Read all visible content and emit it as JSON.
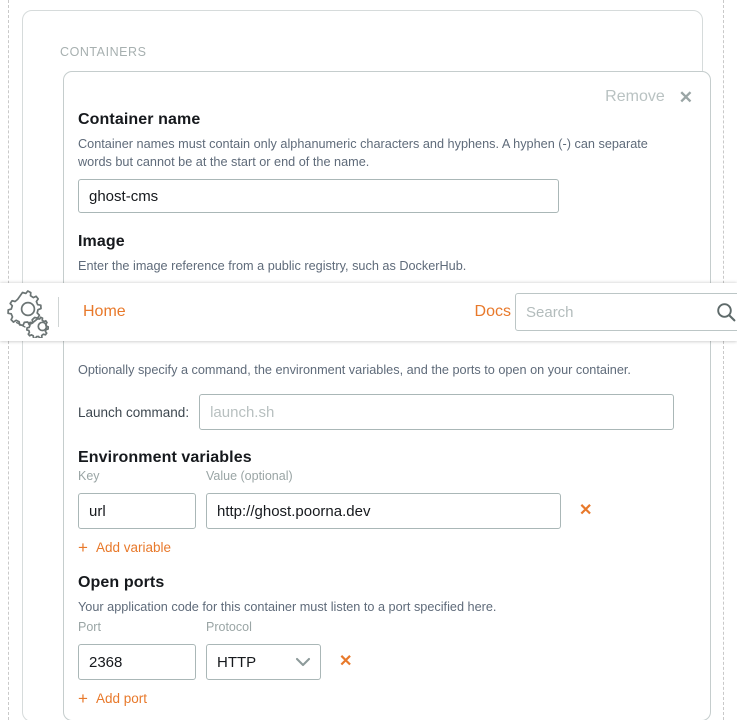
{
  "section": {
    "label": "CONTAINERS"
  },
  "container_card": {
    "remove_label": "Remove",
    "remove_icon": "close-icon",
    "fields": {
      "container_name": {
        "heading": "Container name",
        "help": "Container names must contain only alphanumeric characters and hyphens. A hyphen (-) can separate words but cannot be at the start or end of the name.",
        "value": "ghost-cms",
        "placeholder": ""
      },
      "image": {
        "heading": "Image",
        "help": "Enter the image reference from a public registry, such as DockerHub.",
        "value": "",
        "placeholder": ""
      },
      "settings": {
        "help": "Optionally specify a command, the environment variables, and the ports to open on your container."
      },
      "launch_command": {
        "label": "Launch command:",
        "value": "",
        "placeholder": "launch.sh"
      },
      "environment_variables": {
        "heading": "Environment variables",
        "col_key": "Key",
        "col_value": "Value (optional)",
        "rows": [
          {
            "key": "url",
            "value": "http://ghost.poorna.dev",
            "remove_icon": "close-icon"
          }
        ],
        "add_label": "Add variable",
        "add_icon": "plus-icon"
      },
      "open_ports": {
        "heading": "Open ports",
        "help": "Your application code for this container must listen to a port specified here.",
        "col_port": "Port",
        "col_protocol": "Protocol",
        "rows": [
          {
            "port": "2368",
            "protocol": "HTTP",
            "remove_icon": "close-icon",
            "chevron_icon": "chevron-down-icon"
          }
        ],
        "add_label": "Add port",
        "add_icon": "plus-icon"
      }
    }
  },
  "navbar": {
    "logo_icon": "gears-logo-icon",
    "home_label": "Home",
    "docs_label": "Docs",
    "search": {
      "placeholder": "Search",
      "value": "",
      "icon": "search-icon"
    }
  },
  "colors": {
    "accent_orange": "#e8792b",
    "text_dark": "#16191d",
    "help_gray": "#5f6b7a",
    "muted_gray": "#9aa5a5",
    "border_gray": "#aab7b7",
    "card_border": "#d6dbdb"
  }
}
